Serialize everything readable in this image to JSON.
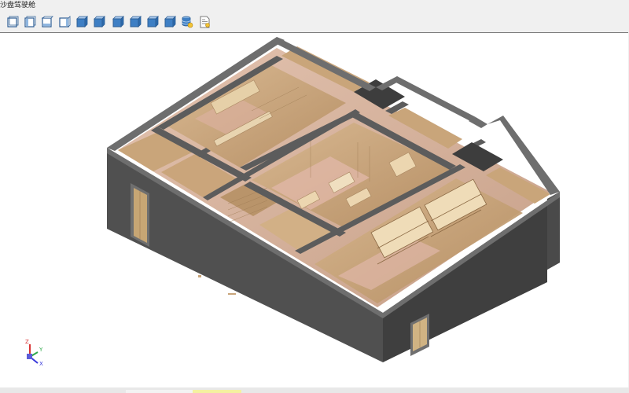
{
  "window": {
    "title": "沙盘驾驶舱"
  },
  "toolbar": {
    "buttons": [
      {
        "name": "view-front-icon"
      },
      {
        "name": "view-back-icon"
      },
      {
        "name": "view-left-icon"
      },
      {
        "name": "view-right-icon"
      },
      {
        "name": "view-top-icon"
      },
      {
        "name": "view-bottom-icon"
      },
      {
        "name": "view-iso-sw-icon"
      },
      {
        "name": "view-iso-se-icon"
      },
      {
        "name": "view-iso-ne-icon"
      },
      {
        "name": "view-iso-nw-icon"
      },
      {
        "name": "layers-database-icon"
      },
      {
        "name": "properties-document-icon"
      }
    ]
  },
  "axis_indicator": {
    "x_label": "X",
    "y_label": "Y",
    "z_label": "Z",
    "x_color": "#3a3adb",
    "y_color": "#2fa84a",
    "z_color": "#d93434"
  },
  "colors": {
    "wall_dark": "#4d4d4d",
    "wall_top": "#6b6b6b",
    "interior_wood": "#c9a57a",
    "floor_pink": "#d9b09c",
    "toolbar_icon_blue": "#3e7fc4"
  }
}
